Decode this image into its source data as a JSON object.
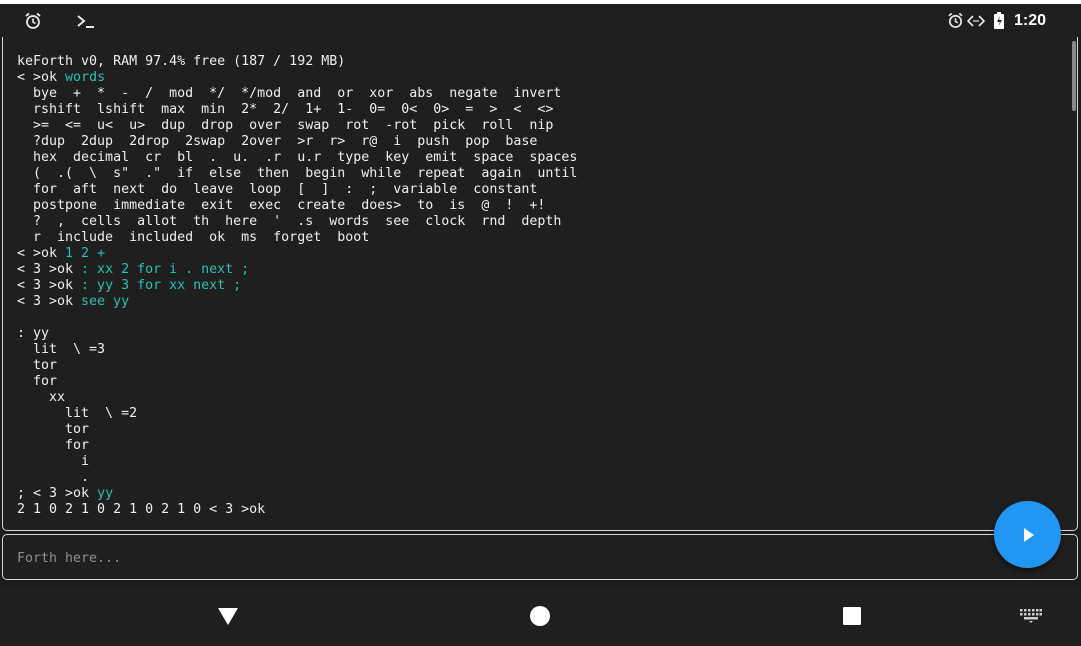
{
  "status_bar": {
    "left_icons": [
      "alarm-icon",
      "terminal-icon"
    ],
    "right_icons": [
      "alarm-icon",
      "data-sync-icon",
      "battery-charging-icon"
    ],
    "time": "1:20"
  },
  "console": {
    "lines": [
      [
        {
          "t": "keForth v0, RAM 97.4% free (187 / 192 MB)"
        }
      ],
      [
        {
          "t": "< >ok "
        },
        {
          "t": "words",
          "c": "cmd"
        }
      ],
      [
        {
          "t": "  bye  +  *  -  /  mod  */  */mod  and  or  xor  abs  negate  invert"
        }
      ],
      [
        {
          "t": "  rshift  lshift  max  min  2*  2/  1+  1-  0=  0<  0>  =  >  <  <>"
        }
      ],
      [
        {
          "t": "  >=  <=  u<  u>  dup  drop  over  swap  rot  -rot  pick  roll  nip"
        }
      ],
      [
        {
          "t": "  ?dup  2dup  2drop  2swap  2over  >r  r>  r@  i  push  pop  base"
        }
      ],
      [
        {
          "t": "  hex  decimal  cr  bl  .  u.  .r  u.r  type  key  emit  space  spaces"
        }
      ],
      [
        {
          "t": "  (  .(  \\  s\"  .\"  if  else  then  begin  while  repeat  again  until"
        }
      ],
      [
        {
          "t": "  for  aft  next  do  leave  loop  [  ]  :  ;  variable  constant"
        }
      ],
      [
        {
          "t": "  postpone  immediate  exit  exec  create  does>  to  is  @  !  +!"
        }
      ],
      [
        {
          "t": "  ?  ,  cells  allot  th  here  '  .s  words  see  clock  rnd  depth"
        }
      ],
      [
        {
          "t": "  r  include  included  ok  ms  forget  boot"
        }
      ],
      [
        {
          "t": "< >ok "
        },
        {
          "t": "1 2 +",
          "c": "cmd"
        }
      ],
      [
        {
          "t": "< 3 >ok "
        },
        {
          "t": ": xx 2 for i . next ;",
          "c": "cmd"
        }
      ],
      [
        {
          "t": "< 3 >ok "
        },
        {
          "t": ": yy 3 for xx next ;",
          "c": "cmd"
        }
      ],
      [
        {
          "t": "< 3 >ok "
        },
        {
          "t": "see yy",
          "c": "cmd"
        }
      ],
      [
        {
          "t": ""
        }
      ],
      [
        {
          "t": ": yy"
        }
      ],
      [
        {
          "t": "  lit  \\ =3"
        }
      ],
      [
        {
          "t": "  tor"
        }
      ],
      [
        {
          "t": "  for"
        }
      ],
      [
        {
          "t": "    xx"
        }
      ],
      [
        {
          "t": "      lit  \\ =2"
        }
      ],
      [
        {
          "t": "      tor"
        }
      ],
      [
        {
          "t": "      for"
        }
      ],
      [
        {
          "t": "        i"
        }
      ],
      [
        {
          "t": "        ."
        }
      ],
      [
        {
          "t": "; < 3 >ok "
        },
        {
          "t": "yy",
          "c": "cmd"
        }
      ],
      [
        {
          "t": "2 1 0 2 1 0 2 1 0 2 1 0 < 3 >ok"
        }
      ]
    ]
  },
  "input": {
    "placeholder": "Forth here...",
    "value": ""
  },
  "run_button": {
    "icon": "play-icon"
  },
  "nav_bar": {
    "buttons": [
      "back-icon",
      "home-icon",
      "recents-icon",
      "keyboard-icon"
    ]
  },
  "colors": {
    "background": "#1f1f1f",
    "text": "#efefef",
    "command": "#27c2b0",
    "accent": "#2196f3"
  }
}
